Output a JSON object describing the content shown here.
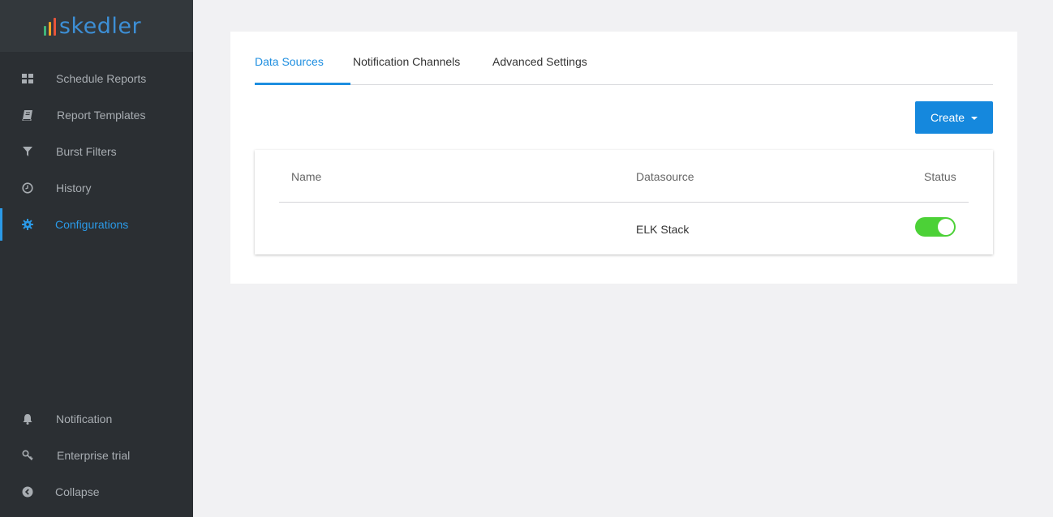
{
  "app": {
    "logo_text": "skedler",
    "logo_bar_colors": [
      "#3fb47a",
      "#f5a623",
      "#e8543a"
    ]
  },
  "sidebar": {
    "items": [
      {
        "label": "Schedule Reports",
        "icon": "grid-icon"
      },
      {
        "label": "Report Templates",
        "icon": "book-icon"
      },
      {
        "label": "Burst Filters",
        "icon": "filter-icon"
      },
      {
        "label": "History",
        "icon": "clock-icon"
      },
      {
        "label": "Configurations",
        "icon": "gear-icon",
        "active": true
      }
    ],
    "bottom_items": [
      {
        "label": "Notification",
        "icon": "bell-icon"
      },
      {
        "label": "Enterprise trial",
        "icon": "key-icon"
      },
      {
        "label": "Collapse",
        "icon": "chevron-left-circle-icon"
      }
    ]
  },
  "tabs": [
    {
      "label": "Data Sources",
      "active": true
    },
    {
      "label": "Notification Channels"
    },
    {
      "label": "Advanced Settings"
    }
  ],
  "toolbar": {
    "create_label": "Create"
  },
  "table": {
    "columns": [
      "Name",
      "Datasource",
      "Status"
    ],
    "rows": [
      {
        "name": "",
        "datasource": "ELK Stack",
        "status_enabled": true
      }
    ]
  },
  "colors": {
    "accent": "#1588dd",
    "toggle_on": "#4cd137",
    "sidebar_bg": "#2b2f33"
  }
}
